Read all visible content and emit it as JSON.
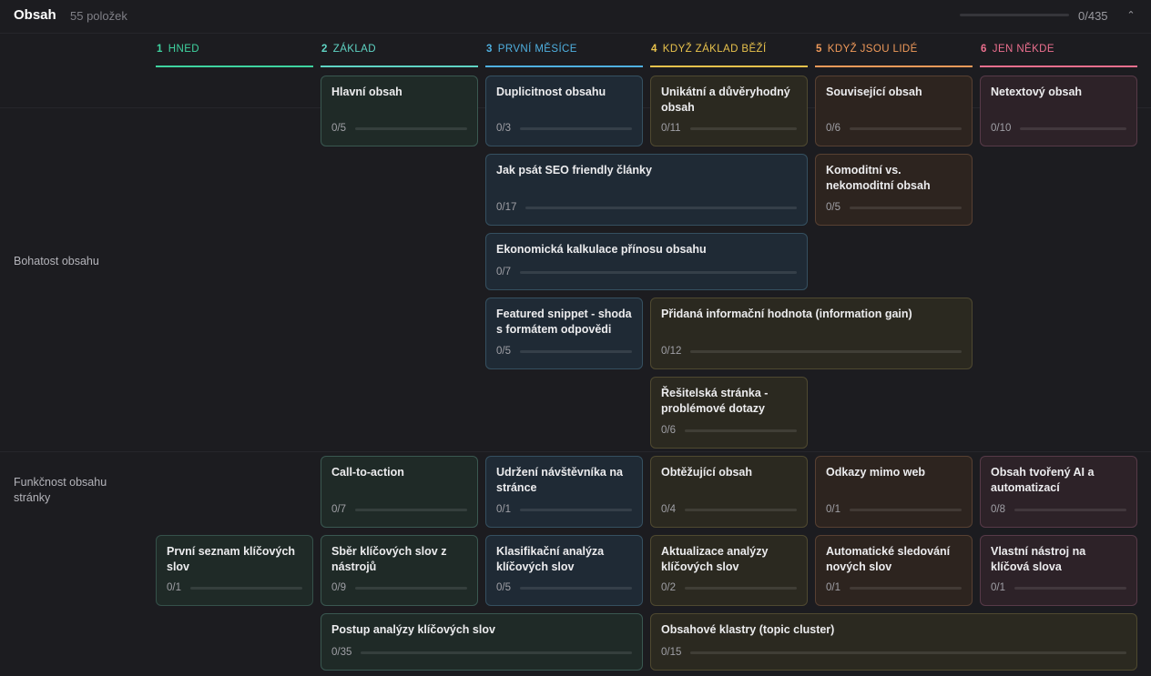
{
  "header": {
    "title": "Obsah",
    "count": "55 položek",
    "progress": "0/435",
    "progress_fraction": 0,
    "collapse_icon": "chevron-up-icon"
  },
  "columns": [
    {
      "num": "1",
      "label": "HNED",
      "color": "#3fd3a0"
    },
    {
      "num": "2",
      "label": "ZÁKLAD",
      "color": "#5fd4c4"
    },
    {
      "num": "3",
      "label": "PRVNÍ MĚSÍCE",
      "color": "#4fb0e0"
    },
    {
      "num": "4",
      "label": "KDYŽ ZÁKLAD BĚŽÍ",
      "color": "#e8c24c"
    },
    {
      "num": "5",
      "label": "KDYŽ JSOU LIDÉ",
      "color": "#f09a5a"
    },
    {
      "num": "6",
      "label": "JEN NĚKDE",
      "color": "#ec6f8e"
    }
  ],
  "rows": [
    {
      "label": "Bohatost obsahu"
    },
    {
      "label": "Funkčnost obsahu stránky"
    }
  ],
  "cards": [
    {
      "title": "Hlavní obsah",
      "progress": "0/5"
    },
    {
      "title": "Duplicitnost obsahu",
      "progress": "0/3"
    },
    {
      "title": "Unikátní a důvěryhodný obsah",
      "progress": "0/11"
    },
    {
      "title": "Související obsah",
      "progress": "0/6"
    },
    {
      "title": "Netextový obsah",
      "progress": "0/10"
    },
    {
      "title": "Jak psát SEO friendly články",
      "progress": "0/17"
    },
    {
      "title": "Komoditní vs. nekomoditní obsah",
      "progress": "0/5"
    },
    {
      "title": "Ekonomická kalkulace přínosu obsahu",
      "progress": "0/7"
    },
    {
      "title": "Featured snippet - shoda s formátem odpovědi",
      "progress": "0/5"
    },
    {
      "title": "Přidaná informační hodnota (information gain)",
      "progress": "0/12"
    },
    {
      "title": "Řešitelská stránka - problémové dotazy",
      "progress": "0/6"
    },
    {
      "title": "Call-to-action",
      "progress": "0/7"
    },
    {
      "title": "Udržení návštěvníka na stránce",
      "progress": "0/1"
    },
    {
      "title": "Obtěžující obsah",
      "progress": "0/4"
    },
    {
      "title": "Odkazy mimo web",
      "progress": "0/1"
    },
    {
      "title": "Obsah tvořený AI a automatizací",
      "progress": "0/8"
    },
    {
      "title": "První seznam klíčových slov",
      "progress": "0/1"
    },
    {
      "title": "Sběr klíčových slov z nástrojů",
      "progress": "0/9"
    },
    {
      "title": "Klasifikační analýza klíčových slov",
      "progress": "0/5"
    },
    {
      "title": "Aktualizace analýzy klíčových slov",
      "progress": "0/2"
    },
    {
      "title": "Automatické sledování nových slov",
      "progress": "0/1"
    },
    {
      "title": "Vlastní nástroj na klíčová slova",
      "progress": "0/1"
    },
    {
      "title": "Postup analýzy klíčových slov",
      "progress": "0/35"
    },
    {
      "title": "Obsahové klastry (topic cluster)",
      "progress": "0/15"
    }
  ]
}
